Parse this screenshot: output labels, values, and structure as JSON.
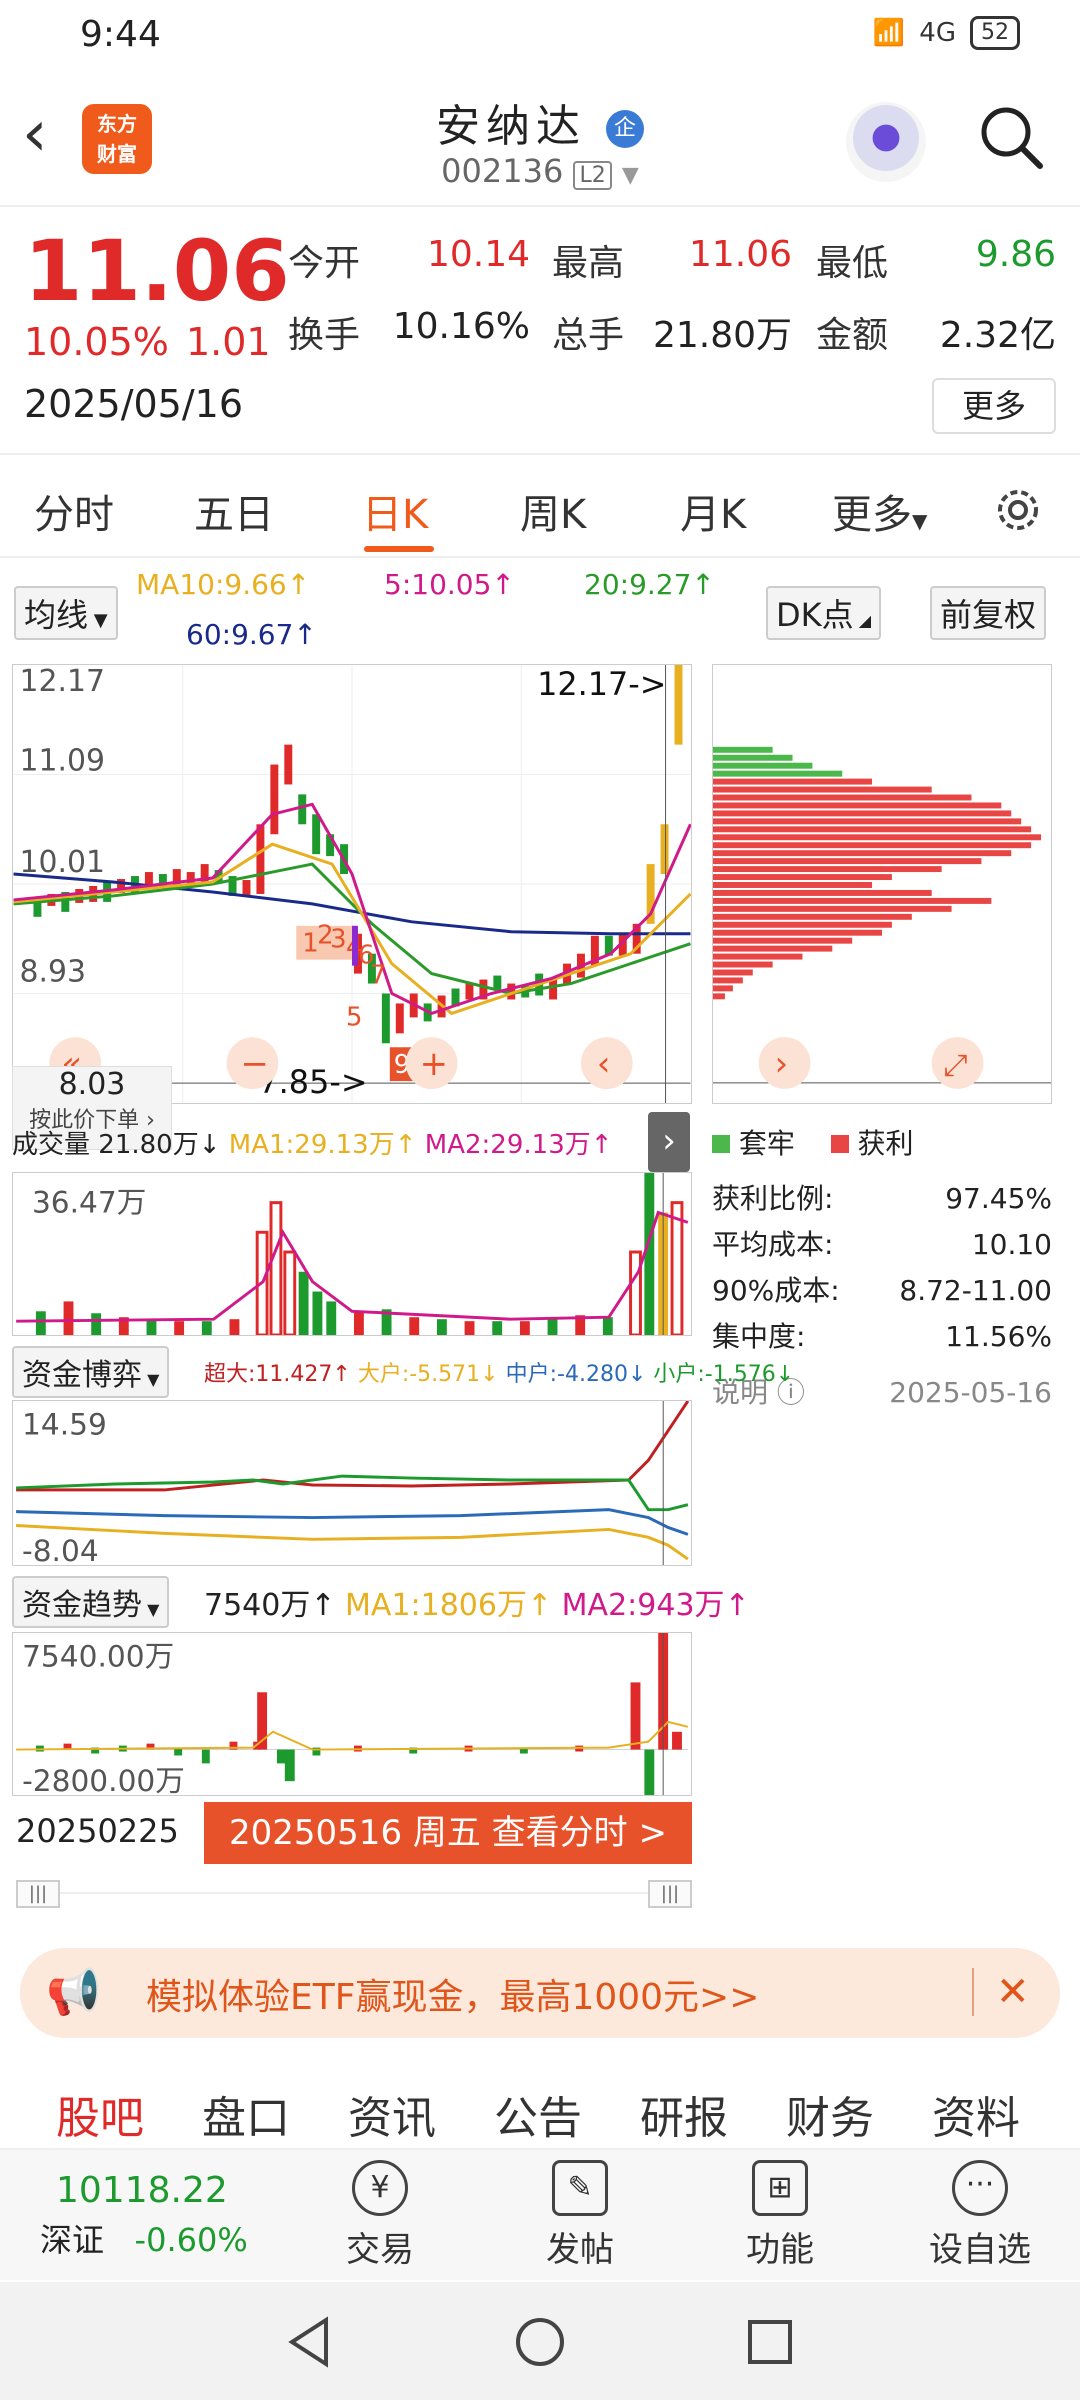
{
  "status": {
    "time": "9:44",
    "network": "4G",
    "battery": "52"
  },
  "header": {
    "logo_line1": "东方",
    "logo_line2": "财富",
    "name": "安纳达",
    "badge": "企",
    "code": "002136",
    "level": "L2"
  },
  "quote": {
    "price": "11.06",
    "change_pct": "10.05%",
    "change": "1.01",
    "date": "2025/05/16",
    "open_label": "今开",
    "open": "10.14",
    "high_label": "最高",
    "high": "11.06",
    "low_label": "最低",
    "low": "9.86",
    "turnover_label": "换手",
    "turnover": "10.16%",
    "volume_label": "总手",
    "volume": "21.80万",
    "amount_label": "金额",
    "amount": "2.32亿",
    "more": "更多"
  },
  "tabs": [
    "分时",
    "五日",
    "日K",
    "周K",
    "月K",
    "更多"
  ],
  "active_tab": "日K",
  "ma": {
    "selector": "均线",
    "ma10": "MA10:9.66↑",
    "ma5": "5:10.05↑",
    "ma20": "20:9.27↑",
    "ma60": "60:9.67↑",
    "dk": "DK点",
    "adjust": "前复权"
  },
  "kline": {
    "y_labels": [
      "12.17",
      "11.09",
      "10.01",
      "8.93"
    ],
    "max_marker": "12.17->",
    "min_marker": "7.85->",
    "cursor_price": "8.03",
    "cursor_order": "按此价下单",
    "seq_labels": [
      "1",
      "2",
      "3",
      "4",
      "6",
      "7",
      "5",
      "9"
    ],
    "colors": {
      "up": "#e02a2a",
      "down": "#1c9a2e",
      "ma5": "#d01a8a",
      "ma10": "#e8b020",
      "ma20": "#2a9a2a",
      "ma60": "#1a2a8a"
    }
  },
  "chip": {
    "legend_trapped": "套牢",
    "legend_profit": "获利",
    "rows": [
      {
        "label": "获利比例:",
        "value": "97.45%"
      },
      {
        "label": "平均成本:",
        "value": "10.10"
      },
      {
        "label": "90%成本:",
        "value": "8.72-11.00"
      },
      {
        "label": "集中度:",
        "value": "11.56%"
      }
    ],
    "note": "说明",
    "note_date": "2025-05-16"
  },
  "volume": {
    "label": "成交量",
    "value": "21.80万↓",
    "ma1": "MA1:29.13万↑",
    "ma2": "MA2:29.13万↑",
    "top": "36.47万"
  },
  "capital_game": {
    "selector": "资金博弈",
    "super": "超大:11.427↑",
    "big": "大户:-5.571↓",
    "mid": "中户:-4.280↓",
    "small": "小户:-1.576↓",
    "top": "14.59",
    "bottom": "-8.04"
  },
  "capital_trend": {
    "selector": "资金趋势",
    "value": "7540万↑",
    "ma1": "MA1:1806万↑",
    "ma2": "MA2:943万↑",
    "top": "7540.00万",
    "bottom": "-2800.00万"
  },
  "timeline": {
    "start": "20250225",
    "cta": "20250516 周五 查看分时 >"
  },
  "banner": {
    "text": "模拟体验ETF赢现金，最高1000元>>"
  },
  "bottom_tabs": [
    "股吧",
    "盘口",
    "资讯",
    "公告",
    "研报",
    "财务",
    "资料"
  ],
  "index": {
    "value": "10118.22",
    "name": "深证",
    "change": "-0.60%"
  },
  "nav": [
    "交易",
    "发帖",
    "功能",
    "设自选"
  ]
}
